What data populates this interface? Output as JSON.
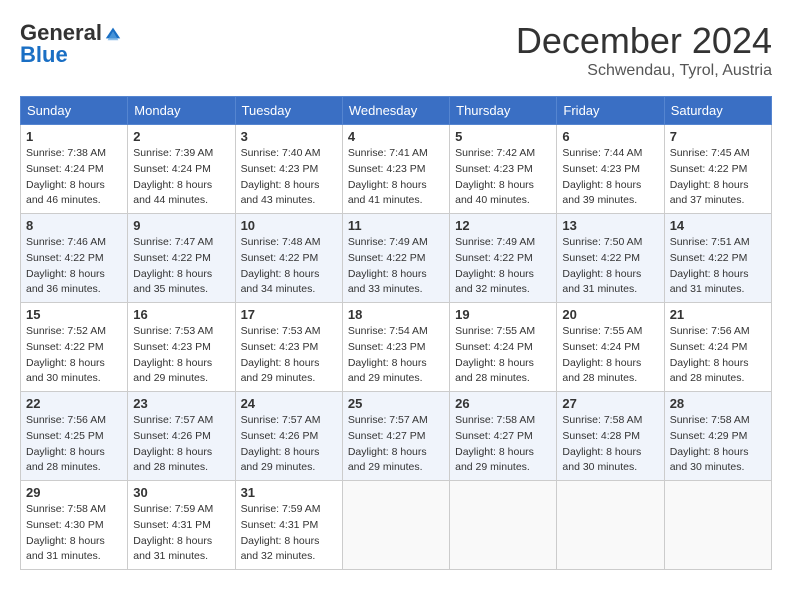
{
  "header": {
    "logo_general": "General",
    "logo_blue": "Blue",
    "month_title": "December 2024",
    "location": "Schwendau, Tyrol, Austria"
  },
  "days_of_week": [
    "Sunday",
    "Monday",
    "Tuesday",
    "Wednesday",
    "Thursday",
    "Friday",
    "Saturday"
  ],
  "weeks": [
    [
      {
        "day": "1",
        "sunrise": "7:38 AM",
        "sunset": "4:24 PM",
        "daylight": "8 hours and 46 minutes."
      },
      {
        "day": "2",
        "sunrise": "7:39 AM",
        "sunset": "4:24 PM",
        "daylight": "8 hours and 44 minutes."
      },
      {
        "day": "3",
        "sunrise": "7:40 AM",
        "sunset": "4:23 PM",
        "daylight": "8 hours and 43 minutes."
      },
      {
        "day": "4",
        "sunrise": "7:41 AM",
        "sunset": "4:23 PM",
        "daylight": "8 hours and 41 minutes."
      },
      {
        "day": "5",
        "sunrise": "7:42 AM",
        "sunset": "4:23 PM",
        "daylight": "8 hours and 40 minutes."
      },
      {
        "day": "6",
        "sunrise": "7:44 AM",
        "sunset": "4:23 PM",
        "daylight": "8 hours and 39 minutes."
      },
      {
        "day": "7",
        "sunrise": "7:45 AM",
        "sunset": "4:22 PM",
        "daylight": "8 hours and 37 minutes."
      }
    ],
    [
      {
        "day": "8",
        "sunrise": "7:46 AM",
        "sunset": "4:22 PM",
        "daylight": "8 hours and 36 minutes."
      },
      {
        "day": "9",
        "sunrise": "7:47 AM",
        "sunset": "4:22 PM",
        "daylight": "8 hours and 35 minutes."
      },
      {
        "day": "10",
        "sunrise": "7:48 AM",
        "sunset": "4:22 PM",
        "daylight": "8 hours and 34 minutes."
      },
      {
        "day": "11",
        "sunrise": "7:49 AM",
        "sunset": "4:22 PM",
        "daylight": "8 hours and 33 minutes."
      },
      {
        "day": "12",
        "sunrise": "7:49 AM",
        "sunset": "4:22 PM",
        "daylight": "8 hours and 32 minutes."
      },
      {
        "day": "13",
        "sunrise": "7:50 AM",
        "sunset": "4:22 PM",
        "daylight": "8 hours and 31 minutes."
      },
      {
        "day": "14",
        "sunrise": "7:51 AM",
        "sunset": "4:22 PM",
        "daylight": "8 hours and 31 minutes."
      }
    ],
    [
      {
        "day": "15",
        "sunrise": "7:52 AM",
        "sunset": "4:22 PM",
        "daylight": "8 hours and 30 minutes."
      },
      {
        "day": "16",
        "sunrise": "7:53 AM",
        "sunset": "4:23 PM",
        "daylight": "8 hours and 29 minutes."
      },
      {
        "day": "17",
        "sunrise": "7:53 AM",
        "sunset": "4:23 PM",
        "daylight": "8 hours and 29 minutes."
      },
      {
        "day": "18",
        "sunrise": "7:54 AM",
        "sunset": "4:23 PM",
        "daylight": "8 hours and 29 minutes."
      },
      {
        "day": "19",
        "sunrise": "7:55 AM",
        "sunset": "4:24 PM",
        "daylight": "8 hours and 28 minutes."
      },
      {
        "day": "20",
        "sunrise": "7:55 AM",
        "sunset": "4:24 PM",
        "daylight": "8 hours and 28 minutes."
      },
      {
        "day": "21",
        "sunrise": "7:56 AM",
        "sunset": "4:24 PM",
        "daylight": "8 hours and 28 minutes."
      }
    ],
    [
      {
        "day": "22",
        "sunrise": "7:56 AM",
        "sunset": "4:25 PM",
        "daylight": "8 hours and 28 minutes."
      },
      {
        "day": "23",
        "sunrise": "7:57 AM",
        "sunset": "4:26 PM",
        "daylight": "8 hours and 28 minutes."
      },
      {
        "day": "24",
        "sunrise": "7:57 AM",
        "sunset": "4:26 PM",
        "daylight": "8 hours and 29 minutes."
      },
      {
        "day": "25",
        "sunrise": "7:57 AM",
        "sunset": "4:27 PM",
        "daylight": "8 hours and 29 minutes."
      },
      {
        "day": "26",
        "sunrise": "7:58 AM",
        "sunset": "4:27 PM",
        "daylight": "8 hours and 29 minutes."
      },
      {
        "day": "27",
        "sunrise": "7:58 AM",
        "sunset": "4:28 PM",
        "daylight": "8 hours and 30 minutes."
      },
      {
        "day": "28",
        "sunrise": "7:58 AM",
        "sunset": "4:29 PM",
        "daylight": "8 hours and 30 minutes."
      }
    ],
    [
      {
        "day": "29",
        "sunrise": "7:58 AM",
        "sunset": "4:30 PM",
        "daylight": "8 hours and 31 minutes."
      },
      {
        "day": "30",
        "sunrise": "7:59 AM",
        "sunset": "4:31 PM",
        "daylight": "8 hours and 31 minutes."
      },
      {
        "day": "31",
        "sunrise": "7:59 AM",
        "sunset": "4:31 PM",
        "daylight": "8 hours and 32 minutes."
      },
      null,
      null,
      null,
      null
    ]
  ],
  "labels": {
    "sunrise": "Sunrise:",
    "sunset": "Sunset:",
    "daylight": "Daylight:"
  }
}
